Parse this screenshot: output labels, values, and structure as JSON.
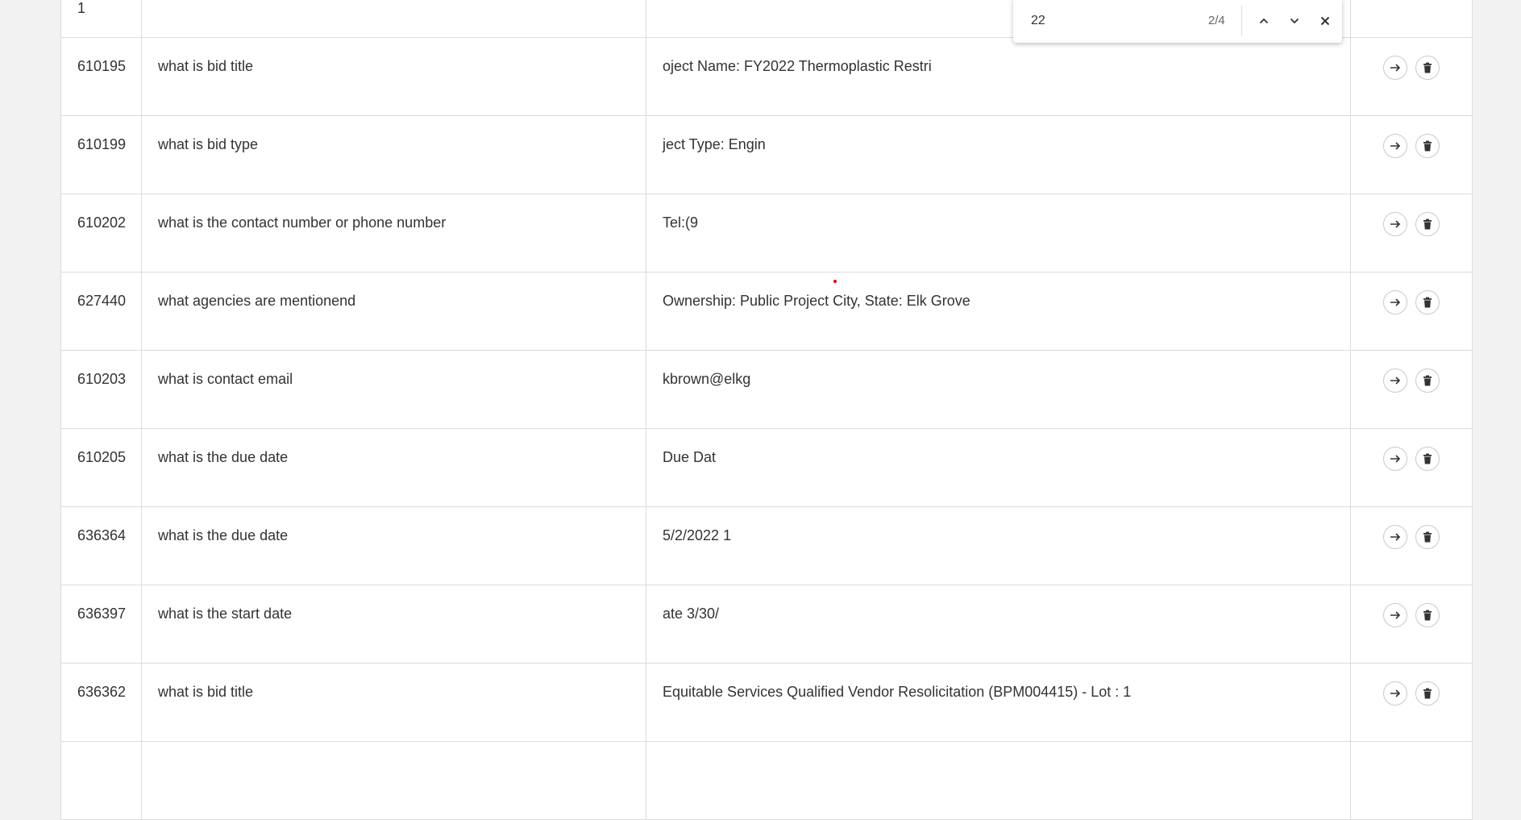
{
  "find_bar": {
    "query": "22",
    "match_count": "2/4"
  },
  "rows": [
    {
      "id": "1",
      "question": "",
      "answer": ""
    },
    {
      "id": "610195",
      "question": "what is bid title",
      "answer": "oject Name: FY2022 Thermoplastic Restri"
    },
    {
      "id": "610199",
      "question": "what is bid type",
      "answer": "ject Type: Engin"
    },
    {
      "id": "610202",
      "question": "what is the contact number or phone number",
      "answer": "Tel:(9"
    },
    {
      "id": "627440",
      "question": "what agencies are mentionend",
      "answer": "Ownership: Public Project City, State: Elk Grove"
    },
    {
      "id": "610203",
      "question": "what is contact email",
      "answer": "kbrown@elkg"
    },
    {
      "id": "610205",
      "question": "what is the due date",
      "answer": "Due Dat"
    },
    {
      "id": "636364",
      "question": "what is the due date",
      "answer": "5/2/2022 1"
    },
    {
      "id": "636397",
      "question": "what is the start date",
      "answer": "ate 3/30/"
    },
    {
      "id": "636362",
      "question": "what is bid title",
      "answer": "Equitable Services Qualified Vendor Resolicitation (BPM004415) - Lot : 1"
    },
    {
      "id": "",
      "question": "",
      "answer": ""
    }
  ],
  "icons": {
    "go": "arrow-right-icon",
    "delete": "trash-icon",
    "prev": "chevron-up-icon",
    "next": "chevron-down-icon",
    "close": "close-icon"
  },
  "colors": {
    "border": "#dcdcdc",
    "background": "#f2f2f2",
    "icon": "#333333",
    "cursor_dot": "#e00000"
  }
}
